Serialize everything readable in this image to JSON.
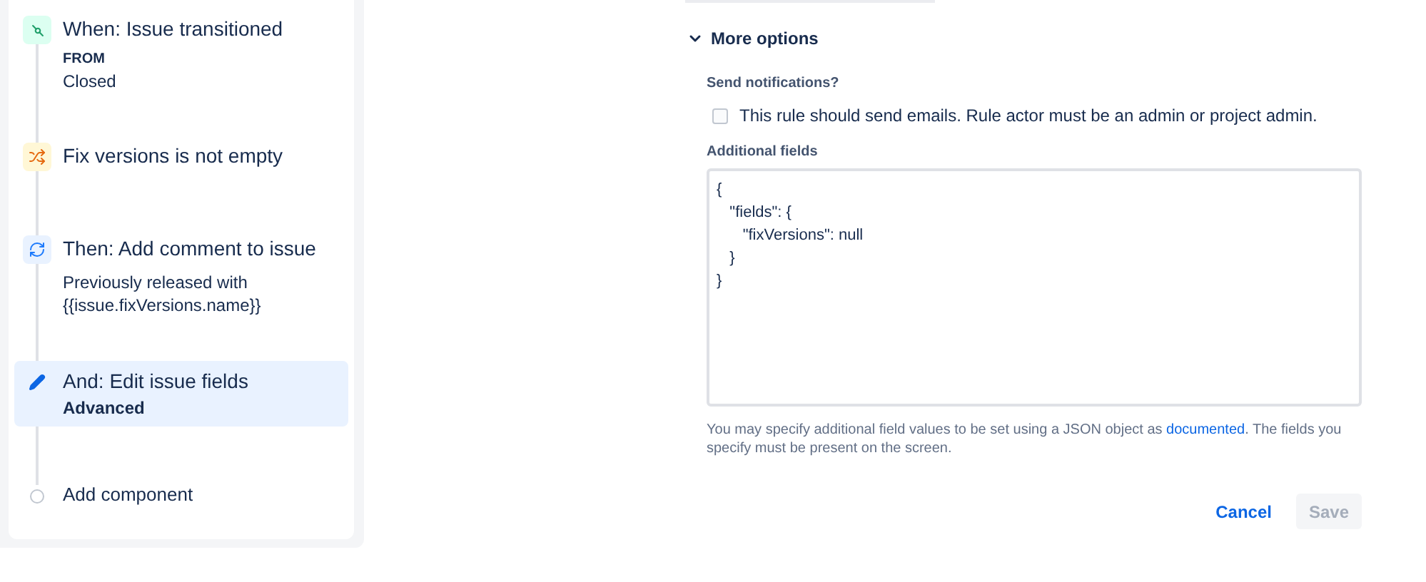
{
  "steps": [
    {
      "kind": "trigger",
      "title": "When: Issue transitioned",
      "label": "FROM",
      "detail": "Closed",
      "selected": false
    },
    {
      "kind": "condition",
      "title": "Fix versions is not empty",
      "selected": false
    },
    {
      "kind": "action",
      "title": "Then: Add comment to issue",
      "detail": "Previously released with {{issue.fixVersions.name}}",
      "selected": false
    },
    {
      "kind": "edit",
      "title": "And: Edit issue fields",
      "label": "Advanced",
      "selected": true
    },
    {
      "kind": "add",
      "title": "Add component",
      "selected": false
    }
  ],
  "more_options": {
    "title": "More options",
    "expanded": true,
    "notifications": {
      "label": "Send notifications?",
      "checkbox": "This rule should send emails. Rule actor must be an admin or project admin.",
      "checked": false
    },
    "additional_fields": {
      "label": "Additional fields",
      "value": "{\n   \"fields\": {\n      \"fixVersions\": null\n   }\n}",
      "help": {
        "before": "You may specify additional field values to be set using a JSON object as ",
        "link": "documented",
        "after": ". The fields you specify must be present on the screen."
      }
    }
  },
  "buttons": [
    {
      "label": "Cancel",
      "kind": "link",
      "disabled": false
    },
    {
      "label": "Save",
      "kind": "primary",
      "disabled": true
    }
  ]
}
